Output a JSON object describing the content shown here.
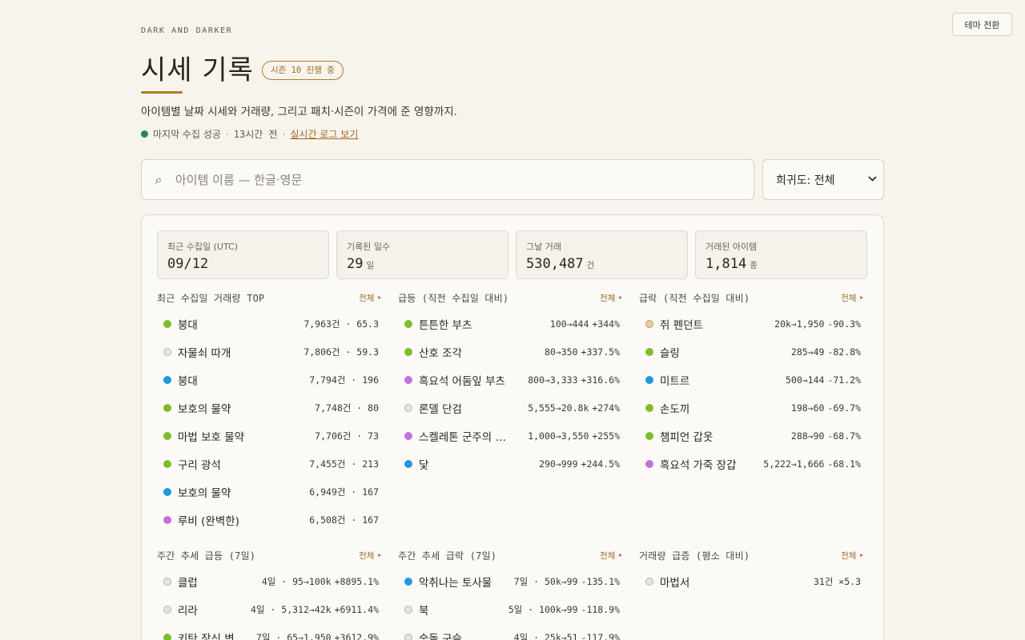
{
  "theme_toggle": "테마 전환",
  "eyebrow": "DARK AND DARKER",
  "title": "시세 기록",
  "season_badge": "시즌 10 진행 중",
  "subtitle": "아이템별 날짜 시세와 거래량, 그리고 패치·시즌이 가격에 준 영향까지.",
  "status": {
    "text": "마지막 수집 성공",
    "sep": "·",
    "ago": "13시간 전",
    "link": "실시간 로그 보기"
  },
  "search": {
    "placeholder": "아이템 이름 — 한글·영문",
    "value": ""
  },
  "rarity_select": {
    "value": "희귀도: 전체"
  },
  "colors": {
    "accent": "#b07a2a",
    "status_ok": "#1f8a5a",
    "up": "#b03030",
    "down": "#2a6aa8",
    "rarity": {
      "uncommon": "#7cc02a",
      "common": "#e6e4dc",
      "rare": "#1f9ae0",
      "epic": "#c070e0",
      "legendary": "#e8d098"
    }
  },
  "stats": [
    {
      "label": "최근 수집일 (UTC)",
      "value": "09/12",
      "unit": ""
    },
    {
      "label": "기록된 일수",
      "value": "29",
      "unit": "일"
    },
    {
      "label": "그날 거래",
      "value": "530,487",
      "unit": "건"
    },
    {
      "label": "거래된 아이템",
      "value": "1,814",
      "unit": "종"
    }
  ],
  "sections": [
    {
      "title": "최근 수집일 거래량 TOP",
      "all": "전체 ‣",
      "rows": [
        {
          "name": "붕대",
          "rarity": "uncommon",
          "meta": "7,963건 · 65.3",
          "change": ""
        },
        {
          "name": "자물쇠 따개",
          "rarity": "common",
          "meta": "7,806건 · 59.3",
          "change": ""
        },
        {
          "name": "붕대",
          "rarity": "rare",
          "meta": "7,794건 · 196",
          "change": ""
        },
        {
          "name": "보호의 물약",
          "rarity": "uncommon",
          "meta": "7,748건 · 80",
          "change": ""
        },
        {
          "name": "마법 보호 물약",
          "rarity": "uncommon",
          "meta": "7,706건 · 73",
          "change": ""
        },
        {
          "name": "구리 광석",
          "rarity": "uncommon",
          "meta": "7,455건 · 213",
          "change": ""
        },
        {
          "name": "보호의 물약",
          "rarity": "rare",
          "meta": "6,949건 · 167",
          "change": ""
        },
        {
          "name": "루비 (완벽한)",
          "rarity": "epic",
          "meta": "6,508건 · 167",
          "change": ""
        }
      ]
    },
    {
      "title": "급등 (직전 수집일 대비)",
      "all": "전체 ‣",
      "rows": [
        {
          "name": "튼튼한 부츠",
          "rarity": "uncommon",
          "meta": "100→444",
          "change": "+344%"
        },
        {
          "name": "산호 조각",
          "rarity": "uncommon",
          "meta": "80→350",
          "change": "+337.5%"
        },
        {
          "name": "흑요석 어둠잎 부츠",
          "rarity": "epic",
          "meta": "800→3,333",
          "change": "+316.6%"
        },
        {
          "name": "론델 단검",
          "rarity": "common",
          "meta": "5,555→20.8k",
          "change": "+274%"
        },
        {
          "name": "스켈레톤 군주의 …",
          "rarity": "epic",
          "meta": "1,000→3,550",
          "change": "+255%"
        },
        {
          "name": "닻",
          "rarity": "rare",
          "meta": "290→999",
          "change": "+244.5%"
        }
      ]
    },
    {
      "title": "급락 (직전 수집일 대비)",
      "all": "전체 ‣",
      "rows": [
        {
          "name": "쥐 펜던트",
          "rarity": "legendary",
          "meta": "20k→1,950",
          "change": "-90.3%"
        },
        {
          "name": "슬링",
          "rarity": "uncommon",
          "meta": "285→49",
          "change": "-82.8%"
        },
        {
          "name": "미트르",
          "rarity": "rare",
          "meta": "500→144",
          "change": "-71.2%"
        },
        {
          "name": "손도끼",
          "rarity": "uncommon",
          "meta": "198→60",
          "change": "-69.7%"
        },
        {
          "name": "챔피언 갑옷",
          "rarity": "uncommon",
          "meta": "288→90",
          "change": "-68.7%"
        },
        {
          "name": "흑요석 가죽 장갑",
          "rarity": "epic",
          "meta": "5,222→1,666",
          "change": "-68.1%"
        }
      ]
    },
    {
      "title": "주간 추세 급등 (7일)",
      "all": "전체 ‣",
      "rows": [
        {
          "name": "클럽",
          "rarity": "common",
          "meta": "4일 · 95→100k",
          "change": "+8895.1%"
        },
        {
          "name": "리라",
          "rarity": "common",
          "meta": "4일 · 5,312→42k",
          "change": "+6911.4%"
        },
        {
          "name": "키탄 장신 변",
          "rarity": "uncommon",
          "meta": "7일 · 65→1,950",
          "change": "+3612.9%"
        }
      ]
    },
    {
      "title": "주간 추세 급락 (7일)",
      "all": "전체 ‣",
      "rows": [
        {
          "name": "악취나는 토사물",
          "rarity": "rare",
          "meta": "7일 · 50k→99",
          "change": "-135.1%"
        },
        {
          "name": "북",
          "rarity": "common",
          "meta": "5일 · 100k→99",
          "change": "-118.9%"
        },
        {
          "name": "숫돌 구슬",
          "rarity": "common",
          "meta": "4일 · 25k→51",
          "change": "-117.9%"
        }
      ]
    },
    {
      "title": "거래량 급증 (평소 대비)",
      "all": "전체 ‣",
      "rows": [
        {
          "name": "마법서",
          "rarity": "common",
          "meta": "31건 ×5.3",
          "change": ""
        }
      ]
    }
  ]
}
